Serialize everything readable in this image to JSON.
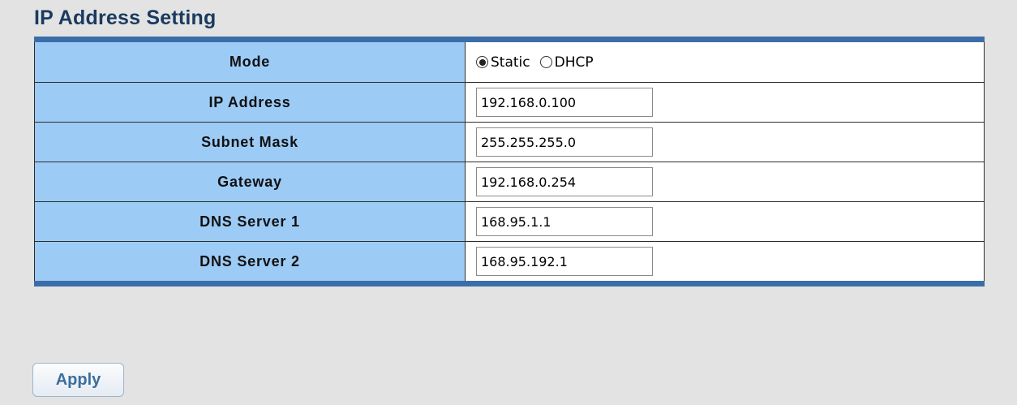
{
  "page": {
    "title": "IP Address Setting"
  },
  "form": {
    "mode": {
      "label": "Mode",
      "options": [
        {
          "label": "Static",
          "selected": true
        },
        {
          "label": "DHCP",
          "selected": false
        }
      ]
    },
    "ip_address": {
      "label": "IP Address",
      "value": "192.168.0.100"
    },
    "subnet_mask": {
      "label": "Subnet Mask",
      "value": "255.255.255.0"
    },
    "gateway": {
      "label": "Gateway",
      "value": "192.168.0.254"
    },
    "dns_server_1": {
      "label": "DNS Server 1",
      "value": "168.95.1.1"
    },
    "dns_server_2": {
      "label": "DNS Server 2",
      "value": "168.95.192.1"
    }
  },
  "actions": {
    "apply_label": "Apply"
  },
  "colors": {
    "page_background": "#e3e3e3",
    "title": "#1a3a5e",
    "label_cell": "#9ccbf6",
    "table_accent": "#3b6ea8",
    "apply_text": "#3d6d9c"
  }
}
